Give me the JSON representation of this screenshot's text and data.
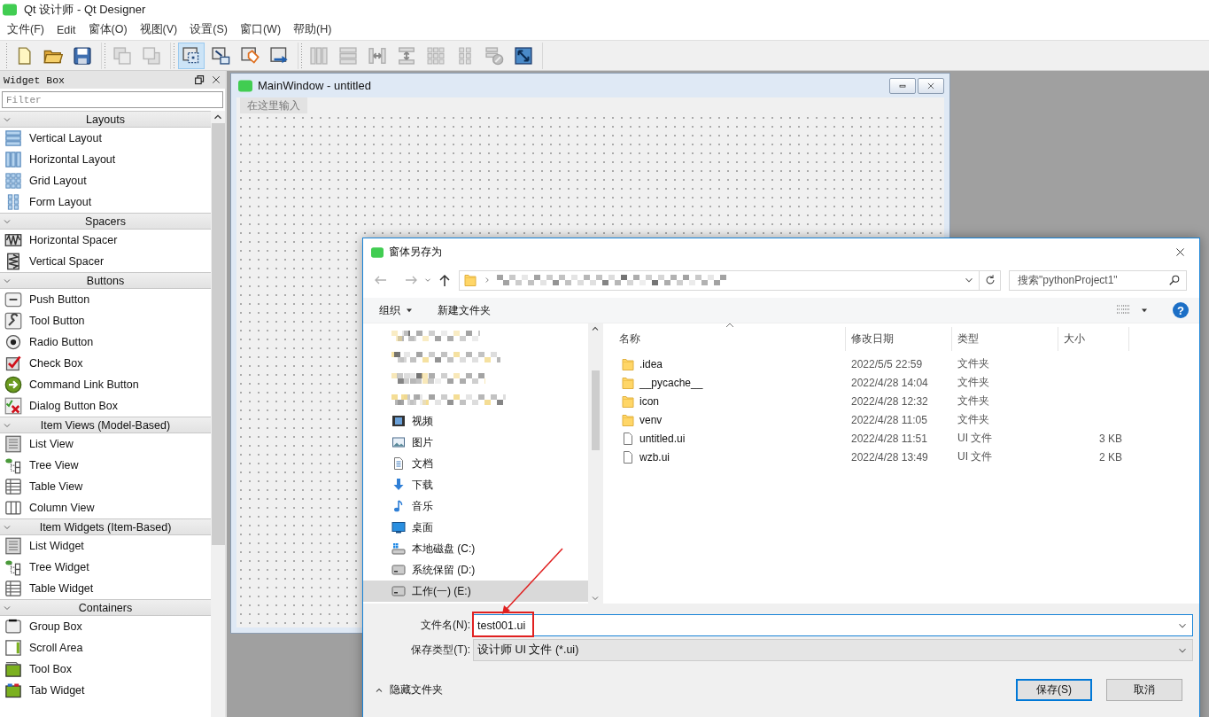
{
  "app": {
    "title": "Qt 设计师 - Qt Designer"
  },
  "menu": [
    "文件(F)",
    "Edit",
    "窗体(O)",
    "视图(V)",
    "设置(S)",
    "窗口(W)",
    "帮助(H)"
  ],
  "toolbar": [
    [
      {
        "kind": "new",
        "disabled": false,
        "selected": false
      },
      {
        "kind": "open",
        "disabled": false,
        "selected": false
      },
      {
        "kind": "save",
        "disabled": false,
        "selected": false
      }
    ],
    [
      {
        "kind": "raise",
        "disabled": true,
        "selected": false
      },
      {
        "kind": "lower",
        "disabled": true,
        "selected": false
      }
    ],
    [
      {
        "kind": "edit-widgets",
        "disabled": false,
        "selected": true
      },
      {
        "kind": "edit-signals",
        "disabled": false,
        "selected": false
      },
      {
        "kind": "edit-buddies",
        "disabled": false,
        "selected": false
      },
      {
        "kind": "edit-tab-order",
        "disabled": false,
        "selected": false
      }
    ],
    [
      {
        "kind": "layout-h",
        "disabled": true,
        "selected": false
      },
      {
        "kind": "layout-v",
        "disabled": true,
        "selected": false
      },
      {
        "kind": "split-h",
        "disabled": true,
        "selected": false
      },
      {
        "kind": "split-v",
        "disabled": true,
        "selected": false
      },
      {
        "kind": "grid",
        "disabled": true,
        "selected": false
      },
      {
        "kind": "form",
        "disabled": true,
        "selected": false
      },
      {
        "kind": "break",
        "disabled": true,
        "selected": false
      },
      {
        "kind": "adjust",
        "disabled": false,
        "selected": false
      }
    ]
  ],
  "widget_box": {
    "title": "Widget Box",
    "filter": {
      "placeholder": "Filter"
    },
    "categories": [
      {
        "name": "Layouts",
        "expanded": true,
        "items": [
          {
            "label": "Vertical Layout",
            "kind": "layout-v"
          },
          {
            "label": "Horizontal Layout",
            "kind": "layout-h"
          },
          {
            "label": "Grid Layout",
            "kind": "grid"
          },
          {
            "label": "Form Layout",
            "kind": "form"
          }
        ]
      },
      {
        "name": "Spacers",
        "expanded": true,
        "items": [
          {
            "label": "Horizontal Spacer",
            "kind": "hspacer"
          },
          {
            "label": "Vertical Spacer",
            "kind": "vspacer"
          }
        ]
      },
      {
        "name": "Buttons",
        "expanded": true,
        "items": [
          {
            "label": "Push Button",
            "kind": "push"
          },
          {
            "label": "Tool Button",
            "kind": "tool"
          },
          {
            "label": "Radio Button",
            "kind": "radio"
          },
          {
            "label": "Check Box",
            "kind": "check"
          },
          {
            "label": "Command Link Button",
            "kind": "command"
          },
          {
            "label": "Dialog Button Box",
            "kind": "buttonbox"
          }
        ]
      },
      {
        "name": "Item Views (Model-Based)",
        "expanded": true,
        "items": [
          {
            "label": "List View",
            "kind": "list"
          },
          {
            "label": "Tree View",
            "kind": "tree"
          },
          {
            "label": "Table View",
            "kind": "table"
          },
          {
            "label": "Column View",
            "kind": "column"
          }
        ]
      },
      {
        "name": "Item Widgets (Item-Based)",
        "expanded": true,
        "items": [
          {
            "label": "List Widget",
            "kind": "list"
          },
          {
            "label": "Tree Widget",
            "kind": "tree"
          },
          {
            "label": "Table Widget",
            "kind": "table"
          }
        ]
      },
      {
        "name": "Containers",
        "expanded": true,
        "items": [
          {
            "label": "Group Box",
            "kind": "group"
          },
          {
            "label": "Scroll Area",
            "kind": "scroll"
          },
          {
            "label": "Tool Box",
            "kind": "toolbox"
          },
          {
            "label": "Tab Widget",
            "kind": "tab"
          }
        ]
      }
    ]
  },
  "form_window": {
    "title": "MainWindow - untitled",
    "menu_placeholder": "在这里输入"
  },
  "dialog": {
    "title": "窗体另存为",
    "search": {
      "placeholder": "搜索\"pythonProject1\""
    },
    "commands": [
      {
        "label": "组织",
        "kind": "menu"
      },
      {
        "label": "新建文件夹",
        "kind": "button"
      }
    ],
    "help": "?",
    "navigation": [
      {
        "kind": "redacted"
      },
      {
        "kind": "redacted"
      },
      {
        "kind": "redacted"
      },
      {
        "kind": "redacted"
      },
      {
        "kind": "videos",
        "label": "视频",
        "selected": false
      },
      {
        "kind": "pictures",
        "label": "图片",
        "selected": false
      },
      {
        "kind": "documents",
        "label": "文档",
        "selected": false
      },
      {
        "kind": "downloads",
        "label": "下载",
        "selected": false
      },
      {
        "kind": "music",
        "label": "音乐",
        "selected": false
      },
      {
        "kind": "desktop",
        "label": "桌面",
        "selected": false
      },
      {
        "kind": "drive-system",
        "label": "本地磁盘 (C:)",
        "selected": false
      },
      {
        "kind": "drive",
        "label": "系统保留 (D:)",
        "selected": false
      },
      {
        "kind": "drive",
        "label": "工作(一) (E:)",
        "selected": true
      }
    ],
    "columns": [
      "名称",
      "修改日期",
      "类型",
      "大小"
    ],
    "files": [
      {
        "kind": "folder",
        "name": ".idea",
        "modified": "2022/5/5 22:59",
        "type": "文件夹"
      },
      {
        "kind": "folder",
        "name": "__pycache__",
        "modified": "2022/4/28 14:04",
        "type": "文件夹"
      },
      {
        "kind": "folder",
        "name": "icon",
        "modified": "2022/4/28 12:32",
        "type": "文件夹"
      },
      {
        "kind": "folder",
        "name": "venv",
        "modified": "2022/4/28 11:05",
        "type": "文件夹"
      },
      {
        "kind": "file",
        "name": "untitled.ui",
        "modified": "2022/4/28 11:51",
        "type": "UI 文件",
        "size": "3 KB"
      },
      {
        "kind": "file",
        "name": "wzb.ui",
        "modified": "2022/4/28 13:49",
        "type": "UI 文件",
        "size": "2 KB"
      }
    ],
    "file_name": {
      "label": "文件名(N):",
      "value": "test001.ui"
    },
    "file_type": {
      "label": "保存类型(T):",
      "value": "设计师 UI 文件 (*.ui)"
    },
    "hide_folders": "隐藏文件夹",
    "buttons": [
      {
        "label": "保存(S)",
        "default": true
      },
      {
        "label": "取消",
        "default": false
      }
    ]
  }
}
